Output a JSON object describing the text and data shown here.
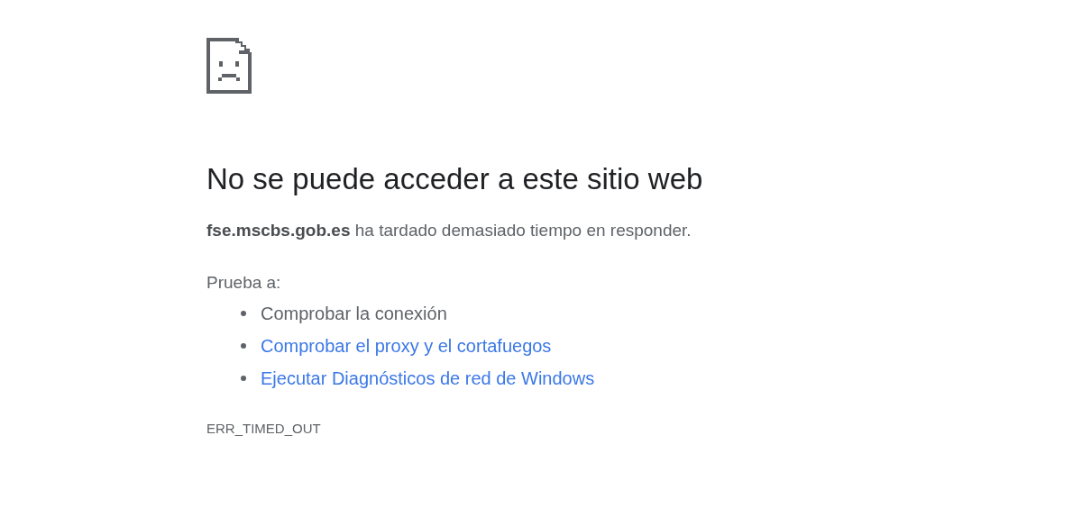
{
  "heading": "No se puede acceder a este sitio web",
  "summary": "**fse.mscbs.gob.es** ha tardado demasiado tiempo en responder.",
  "suggestions_heading": "Prueba a:",
  "suggestions": [
    {
      "text": "Comprobar la conexión",
      "kind": "text"
    },
    {
      "text": "Comprobar el proxy y el cortafuegos",
      "kind": "link"
    },
    {
      "text": "Ejecutar Diagnósticos de red de Windows",
      "kind": "link"
    }
  ],
  "error_code": "ERR_TIMED_OUT"
}
